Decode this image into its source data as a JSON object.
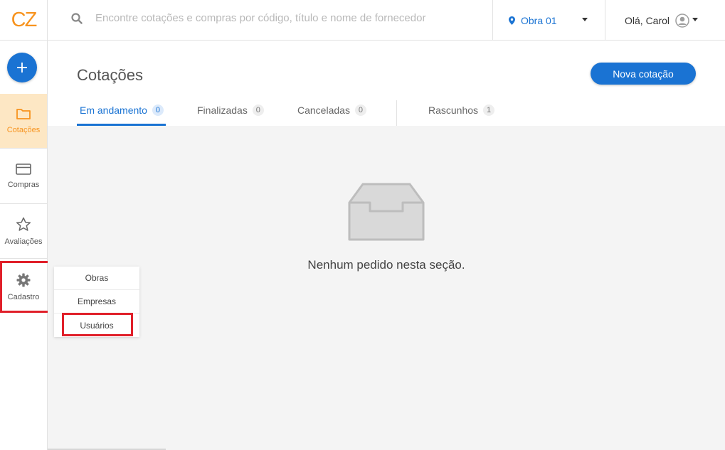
{
  "brand": {
    "logo_text": "CZ",
    "logo_color": "#f7931e",
    "accent_color": "#1a73d3",
    "highlight_color": "#e0202a"
  },
  "search": {
    "placeholder": "Encontre cotações e compras por código, título e nome de fornecedor",
    "icon": "search-icon"
  },
  "obra_selector": {
    "label": "Obra 01",
    "icon": "map-pin-icon"
  },
  "user": {
    "greeting": "Olá, Carol",
    "icon": "user-avatar-icon"
  },
  "sidebar": {
    "add_label": "+",
    "items": [
      {
        "label": "Cotações",
        "icon": "folder-icon",
        "active": true
      },
      {
        "label": "Compras",
        "icon": "credit-card-icon",
        "active": false
      },
      {
        "label": "Avaliações",
        "icon": "star-icon",
        "active": false
      },
      {
        "label": "Cadastro",
        "icon": "gear-icon",
        "active": false,
        "highlighted": true
      }
    ]
  },
  "main": {
    "title": "Cotações",
    "new_button_label": "Nova cotação",
    "tabs": [
      {
        "label": "Em andamento",
        "count": "0",
        "active": true
      },
      {
        "label": "Finalizadas",
        "count": "0",
        "active": false
      },
      {
        "label": "Canceladas",
        "count": "0",
        "active": false
      },
      {
        "label": "Rascunhos",
        "count": "1",
        "active": false
      }
    ],
    "empty_message": "Nenhum pedido nesta seção.",
    "empty_icon": "inbox-tray-icon"
  },
  "cadastro_menu": {
    "items": [
      {
        "label": "Obras"
      },
      {
        "label": "Empresas"
      },
      {
        "label": "Usuários",
        "highlighted": true
      }
    ]
  }
}
